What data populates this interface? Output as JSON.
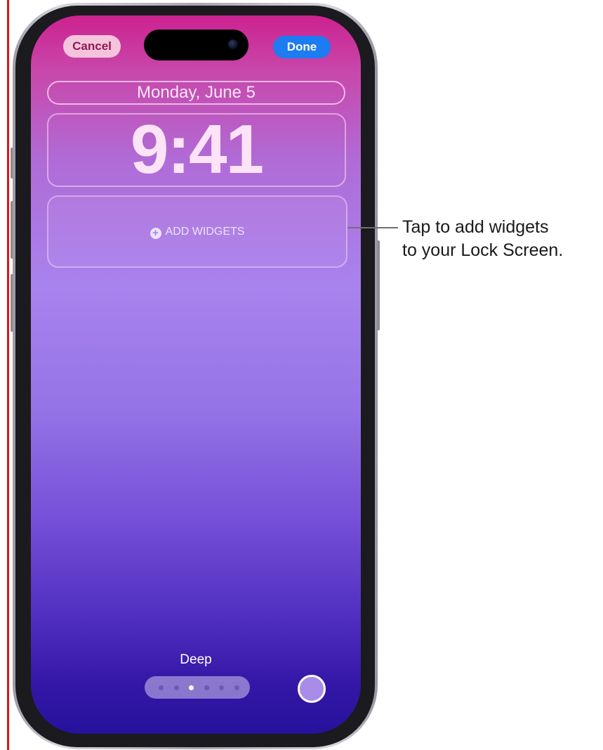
{
  "lock_screen": {
    "cancel_label": "Cancel",
    "done_label": "Done",
    "date": "Monday, June 5",
    "time": "9:41",
    "add_widgets_label": "ADD WIDGETS",
    "style_name": "Deep",
    "page_count": 6,
    "active_page": 3,
    "selected_color": "#a98be8"
  },
  "callout": {
    "line1": "Tap to add widgets",
    "line2": "to your Lock Screen."
  },
  "colors": {
    "done_button": "#1d7cf2",
    "cancel_button": "#f5c4dc",
    "accent_edge": "#e8140f"
  }
}
